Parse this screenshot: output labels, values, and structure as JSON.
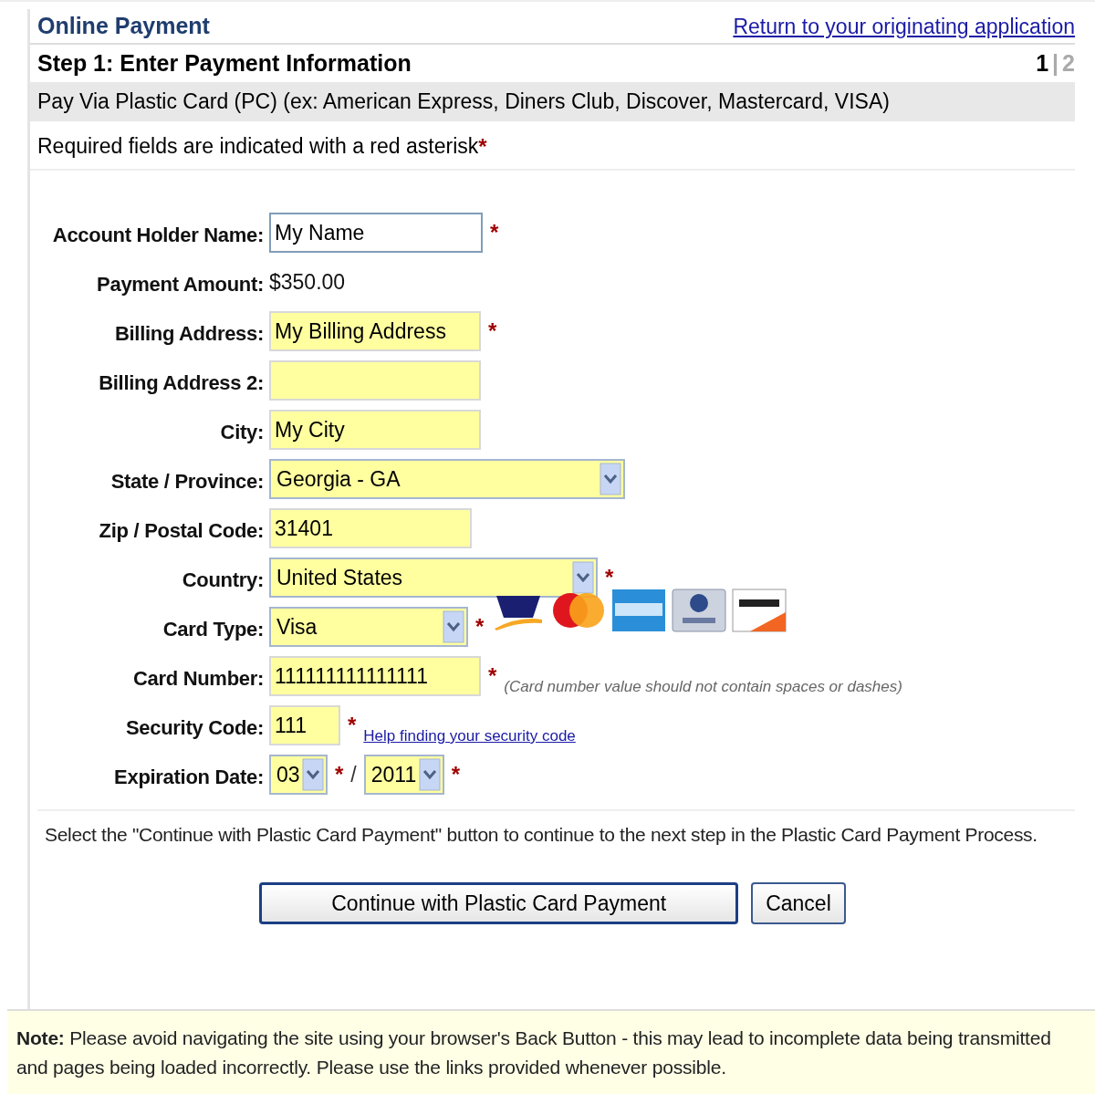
{
  "header": {
    "title": "Online Payment",
    "link": "Return to your originating application"
  },
  "step": {
    "title": "Step 1: Enter Payment Information",
    "separator": "|",
    "pages": [
      {
        "label": "1",
        "selected": true
      },
      {
        "label": "2",
        "selected": false
      }
    ]
  },
  "method": "Pay Via Plastic Card (PC) (ex: American Express, Diners Club, Discover, Mastercard, VISA)",
  "required_note": "Required fields are indicated with a red asterisk",
  "required_mark": "*",
  "fields": [
    {
      "label": "Account Holder Name:",
      "kind": "text",
      "value": "My Name",
      "highlighted": false,
      "required": true
    },
    {
      "label": "Payment Amount:",
      "kind": "static",
      "value": "$350.00"
    },
    {
      "label": "Billing Address:",
      "kind": "text",
      "value": "My Billing Address",
      "highlighted": true,
      "required": true
    },
    {
      "label": "Billing Address 2:",
      "kind": "text",
      "highlighted": true,
      "required": false
    },
    {
      "label": "City:",
      "kind": "text",
      "value": "My City",
      "highlighted": true,
      "required": false
    },
    {
      "label": "State / Province:",
      "kind": "select",
      "value": "Georgia - GA",
      "highlighted": true,
      "required": false
    },
    {
      "label": "Zip / Postal Code:",
      "kind": "text",
      "value": "31401",
      "highlighted": true,
      "required": false
    },
    {
      "label": "Country:",
      "kind": "select",
      "value": "United States",
      "highlighted": true,
      "required": true
    },
    {
      "label": "Card Type:",
      "kind": "card_select",
      "value": "Visa",
      "highlighted": true,
      "required": true
    },
    {
      "label": "Card Number:",
      "kind": "text",
      "value": "111111111111111",
      "highlighted": true,
      "required": true,
      "hint": "(Card number value should not contain spaces or dashes)"
    },
    {
      "label": "Security Code:",
      "kind": "text",
      "value": "111",
      "highlighted": true,
      "required": true,
      "link": "Help finding your security code"
    },
    {
      "label": "Expiration Date:",
      "kind": "date",
      "separator": "/",
      "parts": [
        {
          "value": "03",
          "highlighted": true,
          "required": true
        },
        {
          "value": "2011",
          "highlighted": true,
          "required": true
        }
      ]
    }
  ],
  "instruction": "Select the \"Continue with Plastic Card Payment\" button to continue to the next step in the Plastic Card Payment Process.",
  "buttons": [
    {
      "label": "Continue with Plastic Card Payment",
      "kind": "primary"
    },
    {
      "label": "Cancel",
      "kind": "secondary"
    }
  ],
  "note": {
    "label": "Note:",
    "text": "Please avoid navigating the site using your browser's Back Button - this may lead to incomplete data being transmitted and pages being loaded incorrectly. Please use the links provided whenever possible."
  }
}
